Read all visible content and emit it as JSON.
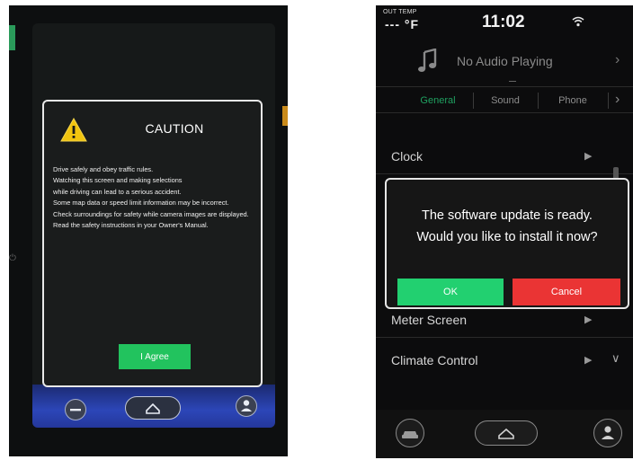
{
  "caution_screen": {
    "title": "CAUTION",
    "lines": [
      "Drive safely and obey traffic rules.",
      "Watching this screen and making selections",
      "while driving can lead to a serious accident.",
      "Some map data or speed limit information may be incorrect.",
      "Check surroundings for safety while camera images are displayed.",
      "Read the safety instructions in your Owner's Manual."
    ],
    "agree_label": "I Agree",
    "icons": [
      "warning-icon",
      "minus-icon",
      "home-icon",
      "person-icon",
      "power-icon"
    ]
  },
  "settings_screen": {
    "status": {
      "out_temp_label": "OUT TEMP",
      "out_temp_value": "--- °F",
      "clock": "11:02"
    },
    "audio": {
      "text": "No Audio Playing"
    },
    "tabs": [
      {
        "label": "General",
        "active": true
      },
      {
        "label": "Sound",
        "active": false
      },
      {
        "label": "Phone",
        "active": false
      }
    ],
    "menu_items": [
      {
        "label": "Clock"
      },
      {
        "label": "Meter Screen"
      },
      {
        "label": "Climate Control"
      }
    ],
    "dialog": {
      "line1": "The software update is ready.",
      "line2": "Would you like to install it now?",
      "ok_label": "OK",
      "cancel_label": "Cancel"
    },
    "icons": [
      "wifi-icon",
      "music-note-icon",
      "car-icon",
      "home-icon",
      "person-icon"
    ]
  },
  "colors": {
    "agree_green": "#22c35e",
    "ok_green": "#22d070",
    "cancel_red": "#ea3434",
    "active_tab": "#1fa060",
    "warning_yellow": "#f1c40f"
  }
}
